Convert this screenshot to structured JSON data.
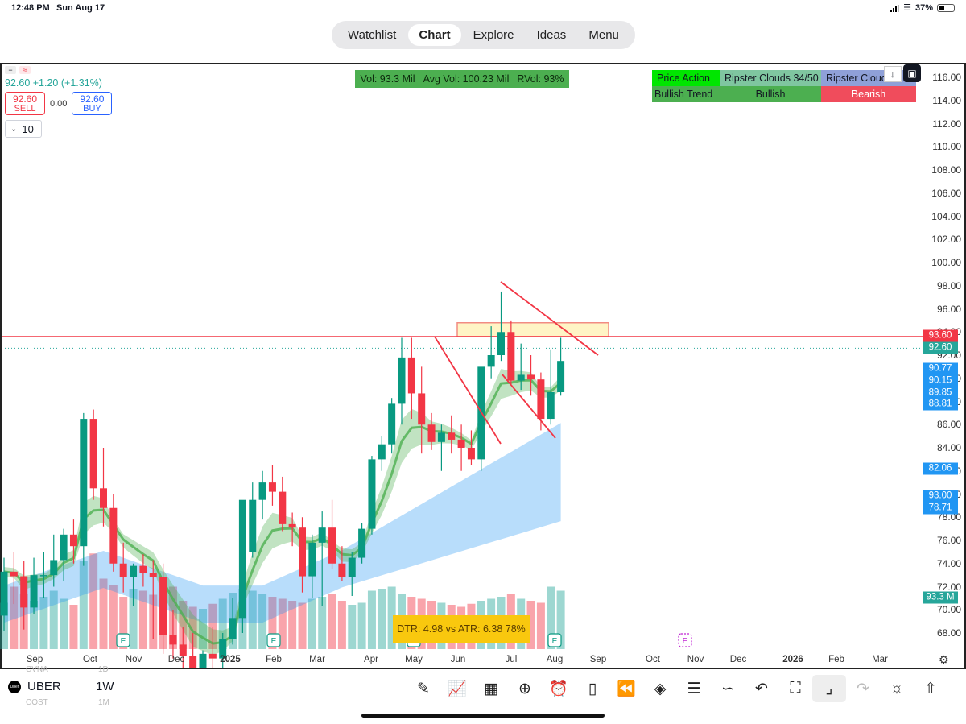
{
  "status": {
    "time": "12:48 PM",
    "date": "Sun Aug 17",
    "battery": "37%"
  },
  "nav": {
    "tabs": [
      "Watchlist",
      "Chart",
      "Explore",
      "Ideas",
      "Menu"
    ],
    "active": "Chart"
  },
  "quote": {
    "price_line": "92.60 +1.20 (+1.31%)",
    "sell_price": "92.60",
    "sell_label": "SELL",
    "spread": "0.00",
    "buy_price": "92.60",
    "buy_label": "BUY",
    "qty": "10"
  },
  "volume_box": {
    "vol": "Vol: 93.3 Mil",
    "avg": "Avg Vol: 100.23 Mil",
    "rvol": "RVol: 93%"
  },
  "indicator_table": {
    "header": [
      "Price Action",
      "Ripster Clouds 34/50",
      "Ripster Cloud"
    ],
    "row": [
      "Bullish Trend",
      "Bullish",
      "Bearish"
    ],
    "colors": {
      "header_1": "#00e600",
      "header_2": "#7fc6a0",
      "header_3": "#8fa0d8",
      "row_1": "#4caf50",
      "row_2": "#4caf50",
      "row_3": "#f04c5c"
    }
  },
  "dtr_box": {
    "text": "DTR: 4.98 vs ATR: 6.38 78%"
  },
  "y_axis": {
    "ticks": [
      "116.00",
      "114.00",
      "112.00",
      "110.00",
      "108.00",
      "106.00",
      "104.00",
      "102.00",
      "100.00",
      "98.00",
      "96.00",
      "94.00",
      "92.00",
      "90.00",
      "88.00",
      "86.00",
      "84.00",
      "82.00",
      "80.00",
      "78.00",
      "76.00",
      "74.00",
      "72.00",
      "70.00",
      "68.00"
    ],
    "labels": [
      {
        "text": "93.60",
        "color": "#f23645"
      },
      {
        "text": "92.60",
        "color": "#26a69a"
      },
      {
        "text": "90.77",
        "color": "#2196f3"
      },
      {
        "text": "90.15",
        "color": "#2196f3"
      },
      {
        "text": "89.85",
        "color": "#2196f3"
      },
      {
        "text": "88.81",
        "color": "#2196f3"
      },
      {
        "text": "82.06",
        "color": "#2196f3"
      },
      {
        "text": "93.00",
        "color": "#2196f3"
      },
      {
        "text": "78.71",
        "color": "#2196f3"
      },
      {
        "text": "93.3 M",
        "color": "#26a69a"
      }
    ]
  },
  "x_axis": {
    "ticks": [
      {
        "text": "Sep",
        "bold": false
      },
      {
        "text": "Oct",
        "bold": false
      },
      {
        "text": "Nov",
        "bold": false
      },
      {
        "text": "Dec",
        "bold": false
      },
      {
        "text": "2025",
        "bold": true
      },
      {
        "text": "Feb",
        "bold": false
      },
      {
        "text": "Mar",
        "bold": false
      },
      {
        "text": "Apr",
        "bold": false
      },
      {
        "text": "May",
        "bold": false
      },
      {
        "text": "Jun",
        "bold": false
      },
      {
        "text": "Jul",
        "bold": false
      },
      {
        "text": "Aug",
        "bold": false
      },
      {
        "text": "Sep",
        "bold": false
      },
      {
        "text": "Oct",
        "bold": false
      },
      {
        "text": "Nov",
        "bold": false
      },
      {
        "text": "Dec",
        "bold": false
      },
      {
        "text": "2026",
        "bold": true
      },
      {
        "text": "Feb",
        "bold": false
      },
      {
        "text": "Mar",
        "bold": false
      }
    ]
  },
  "bottom": {
    "symbol": "UBER",
    "interval": "1W",
    "ghost_above_symbol": "CVNA",
    "ghost_above_interval": "1D",
    "ghost_below_symbol": "COST",
    "ghost_below_interval": "1M",
    "logo_text": "Uber",
    "tools": [
      "pencil-icon",
      "chart-type-icon",
      "grid-icon",
      "plus-circle-icon",
      "alarm-icon",
      "candles-icon",
      "rewind-icon",
      "layers-icon",
      "sliders-icon",
      "indicators-icon",
      "undo-icon",
      "fullscreen-icon",
      "collapse-icon",
      "redo-icon",
      "lightbulb-icon",
      "share-icon"
    ]
  },
  "chart_data": {
    "type": "candlestick",
    "timeframe": "1W",
    "symbol": "UBER",
    "ylim": [
      67,
      117
    ],
    "candles": [
      [
        69.5,
        74.5,
        68.2,
        73.3
      ],
      [
        73.3,
        75.0,
        70.5,
        72.9
      ],
      [
        72.9,
        74.2,
        68.3,
        70.2
      ],
      [
        70.2,
        74.5,
        69.6,
        73.0
      ],
      [
        73.0,
        75.0,
        71.0,
        73.0
      ],
      [
        73.0,
        76.5,
        72.0,
        74.3
      ],
      [
        74.3,
        77.0,
        72.5,
        76.5
      ],
      [
        76.5,
        77.8,
        74.0,
        75.5
      ],
      [
        75.5,
        87.0,
        73.8,
        86.5
      ],
      [
        86.5,
        87.3,
        79.5,
        80.5
      ],
      [
        80.5,
        84.0,
        77.2,
        78.8
      ],
      [
        78.8,
        80.0,
        73.3,
        74.0
      ],
      [
        74.0,
        75.8,
        71.5,
        72.8
      ],
      [
        72.8,
        74.0,
        70.3,
        73.8
      ],
      [
        73.8,
        74.8,
        72.0,
        73.2
      ],
      [
        73.2,
        74.3,
        67.5,
        72.8
      ],
      [
        72.8,
        74.0,
        66.2,
        67.8
      ],
      [
        67.8,
        70.0,
        65.8,
        67.0
      ],
      [
        67.0,
        68.5,
        64.7,
        66.0
      ],
      [
        66.0,
        68.0,
        63.2,
        64.5
      ],
      [
        64.5,
        66.5,
        63.0,
        66.2
      ],
      [
        66.2,
        68.5,
        64.2,
        65.8
      ],
      [
        65.8,
        68.0,
        64.5,
        67.5
      ],
      [
        67.5,
        71.0,
        67.0,
        69.3
      ],
      [
        69.3,
        75.0,
        68.0,
        79.5
      ],
      [
        75.0,
        81.0,
        74.5,
        79.5
      ],
      [
        79.5,
        82.0,
        77.8,
        81.0
      ],
      [
        81.0,
        82.5,
        79.0,
        80.2
      ],
      [
        80.2,
        81.5,
        76.8,
        77.4
      ],
      [
        77.4,
        78.4,
        75.5,
        77.1
      ],
      [
        77.1,
        78.0,
        71.5,
        72.9
      ],
      [
        72.9,
        76.5,
        71.0,
        75.8
      ],
      [
        75.8,
        78.5,
        70.3,
        77.1
      ],
      [
        77.1,
        79.5,
        73.5,
        74.0
      ],
      [
        74.0,
        75.5,
        72.5,
        72.8
      ],
      [
        72.8,
        75.0,
        71.2,
        74.5
      ],
      [
        74.5,
        77.5,
        74.0,
        77.0
      ],
      [
        77.0,
        83.3,
        76.5,
        83.0
      ],
      [
        83.0,
        85.0,
        82.0,
        84.3
      ],
      [
        84.3,
        88.3,
        83.5,
        87.8
      ],
      [
        87.8,
        93.5,
        86.0,
        91.8
      ],
      [
        91.8,
        93.5,
        86.5,
        88.7
      ],
      [
        88.7,
        91.0,
        83.5,
        86.0
      ],
      [
        86.0,
        87.0,
        83.8,
        84.5
      ],
      [
        84.5,
        86.0,
        82.0,
        85.3
      ],
      [
        85.3,
        86.8,
        83.5,
        84.7
      ],
      [
        84.7,
        86.0,
        82.0,
        84.0
      ],
      [
        84.0,
        85.5,
        82.5,
        83.0
      ],
      [
        83.0,
        88.5,
        82.0,
        91.0
      ],
      [
        91.0,
        94.5,
        90.0,
        92.0
      ],
      [
        92.0,
        97.5,
        91.5,
        94.0
      ],
      [
        94.0,
        95.0,
        89.5,
        89.8
      ],
      [
        89.8,
        93.0,
        89.0,
        90.3
      ],
      [
        90.3,
        92.0,
        88.5,
        89.9
      ],
      [
        89.9,
        90.5,
        85.5,
        86.5
      ],
      [
        86.5,
        92.5,
        86.0,
        88.8
      ],
      [
        88.8,
        93.5,
        88.5,
        91.5
      ]
    ],
    "volume": [
      46,
      62,
      55,
      48,
      52,
      58,
      50,
      44,
      88,
      95,
      70,
      64,
      52,
      60,
      58,
      54,
      50,
      62,
      48,
      42,
      40,
      45,
      50,
      56,
      60,
      58,
      55,
      52,
      50,
      48,
      46,
      50,
      52,
      55,
      48,
      44,
      46,
      58,
      60,
      62,
      55,
      52,
      50,
      48,
      46,
      44,
      42,
      45,
      48,
      50,
      52,
      55,
      50,
      48,
      46,
      62,
      58
    ],
    "lines": {
      "resistance": 93.6,
      "current": 92.6,
      "supply_zone": [
        93.6,
        94.8
      ]
    },
    "annotations": [
      "Vol: 93.3 Mil",
      "Avg Vol: 100.23 Mil",
      "RVol: 93%",
      "DTR: 4.98 vs ATR: 6.38 78%"
    ]
  }
}
